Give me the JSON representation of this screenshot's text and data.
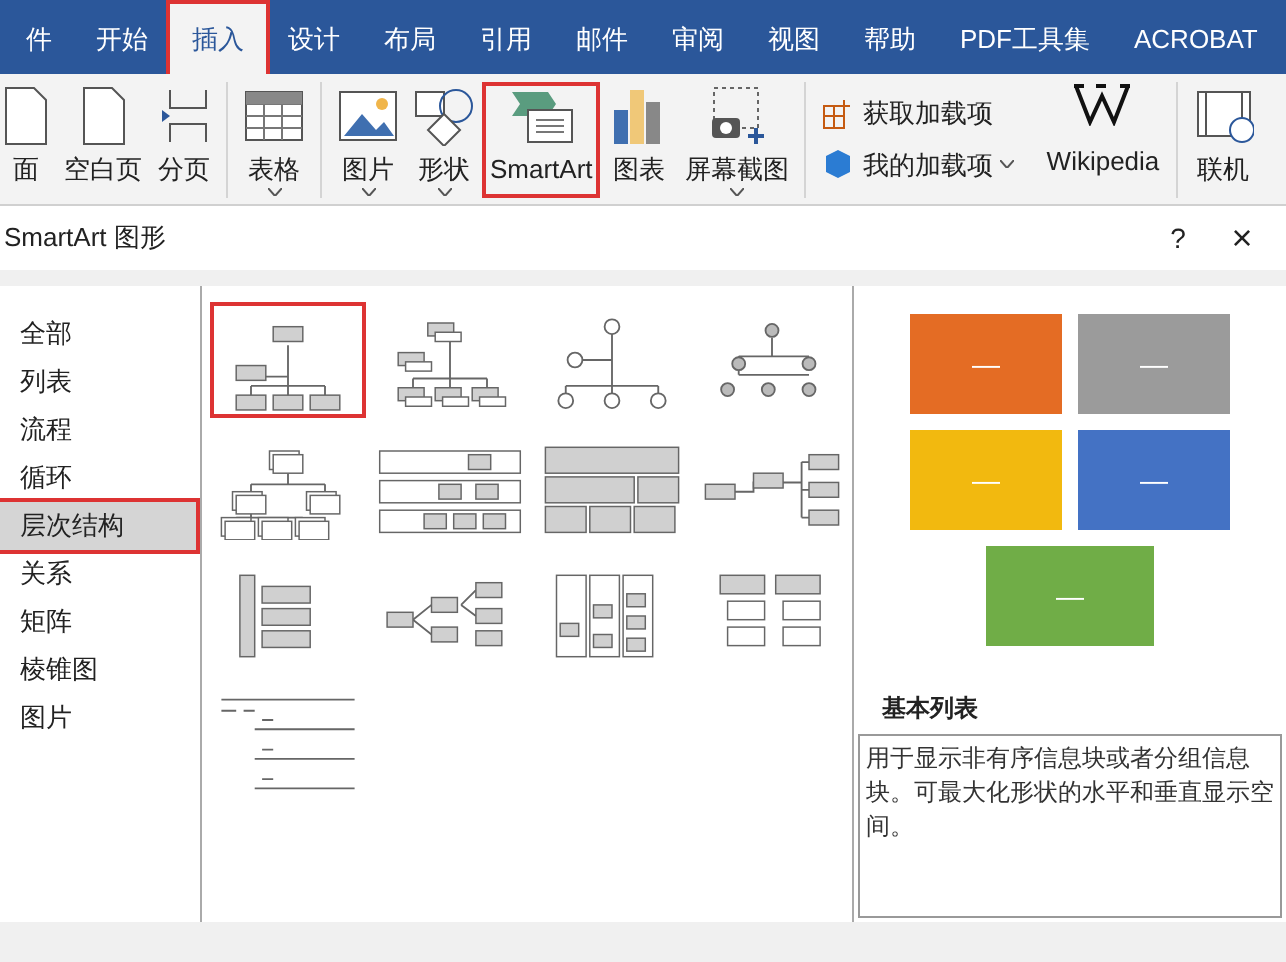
{
  "ribbon_tabs": [
    {
      "label": "件",
      "selected": false,
      "highlighted": false
    },
    {
      "label": "开始",
      "selected": false,
      "highlighted": false
    },
    {
      "label": "插入",
      "selected": true,
      "highlighted": true
    },
    {
      "label": "设计",
      "selected": false,
      "highlighted": false
    },
    {
      "label": "布局",
      "selected": false,
      "highlighted": false
    },
    {
      "label": "引用",
      "selected": false,
      "highlighted": false
    },
    {
      "label": "邮件",
      "selected": false,
      "highlighted": false
    },
    {
      "label": "审阅",
      "selected": false,
      "highlighted": false
    },
    {
      "label": "视图",
      "selected": false,
      "highlighted": false
    },
    {
      "label": "帮助",
      "selected": false,
      "highlighted": false
    },
    {
      "label": "PDF工具集",
      "selected": false,
      "highlighted": false
    },
    {
      "label": "ACROBAT",
      "selected": false,
      "highlighted": false
    }
  ],
  "ribbon_groups": [
    [
      {
        "kind": "cover",
        "label": "面",
        "highlighted": false
      },
      {
        "kind": "blank",
        "label": "空白页",
        "highlighted": false
      },
      {
        "kind": "break",
        "label": "分页",
        "highlighted": false
      }
    ],
    [
      {
        "kind": "table",
        "label": "表格",
        "dropdown": true,
        "highlighted": false
      }
    ],
    [
      {
        "kind": "picture",
        "label": "图片",
        "dropdown": true,
        "highlighted": false
      },
      {
        "kind": "shapes",
        "label": "形状",
        "dropdown": true,
        "highlighted": false
      },
      {
        "kind": "smartart",
        "label": "SmartArt",
        "highlighted": true
      },
      {
        "kind": "chart",
        "label": "图表",
        "highlighted": false
      },
      {
        "kind": "screenshot",
        "label": "屏幕截图",
        "dropdown": true,
        "highlighted": false
      }
    ],
    [
      {
        "kind": "addins",
        "get": "获取加载项",
        "mine": "我的加载项",
        "wiki": "Wikipedia"
      }
    ],
    [
      {
        "kind": "video",
        "label": "联机",
        "highlighted": false
      }
    ]
  ],
  "dialog": {
    "title": "SmartArt 图形",
    "help": "?",
    "close": "×"
  },
  "categories": [
    {
      "label": "全部",
      "selected": false,
      "highlighted": false
    },
    {
      "label": "列表",
      "selected": false,
      "highlighted": false
    },
    {
      "label": "流程",
      "selected": false,
      "highlighted": false
    },
    {
      "label": "循环",
      "selected": false,
      "highlighted": false
    },
    {
      "label": "层次结构",
      "selected": true,
      "highlighted": true
    },
    {
      "label": "关系",
      "selected": false,
      "highlighted": false
    },
    {
      "label": "矩阵",
      "selected": false,
      "highlighted": false
    },
    {
      "label": "棱锥图",
      "selected": false,
      "highlighted": false
    },
    {
      "label": "图片",
      "selected": false,
      "highlighted": false
    }
  ],
  "layouts": [
    {
      "kind": "org",
      "selected": true
    },
    {
      "kind": "name-org",
      "selected": false
    },
    {
      "kind": "circle-org",
      "selected": false
    },
    {
      "kind": "dot-tree",
      "selected": false
    },
    {
      "kind": "stacked-org",
      "selected": false
    },
    {
      "kind": "labeled",
      "selected": false
    },
    {
      "kind": "table",
      "selected": false
    },
    {
      "kind": "horizontal",
      "selected": false
    },
    {
      "kind": "bracket",
      "selected": false
    },
    {
      "kind": "branch",
      "selected": false
    },
    {
      "kind": "columns",
      "selected": false
    },
    {
      "kind": "lists",
      "selected": false
    },
    {
      "kind": "lines",
      "selected": false
    }
  ],
  "preview": {
    "shapes": [
      {
        "label": "—",
        "color": "#e46c24"
      },
      {
        "label": "—",
        "color": "#9b9b9b"
      },
      {
        "label": "—",
        "color": "#f2b90f"
      },
      {
        "label": "—",
        "color": "#4472c4"
      },
      {
        "label": "—",
        "color": "#70ad47"
      }
    ],
    "title": "基本列表",
    "description": "用于显示非有序信息块或者分组信息块。可最大化形状的水平和垂直显示空间。"
  }
}
